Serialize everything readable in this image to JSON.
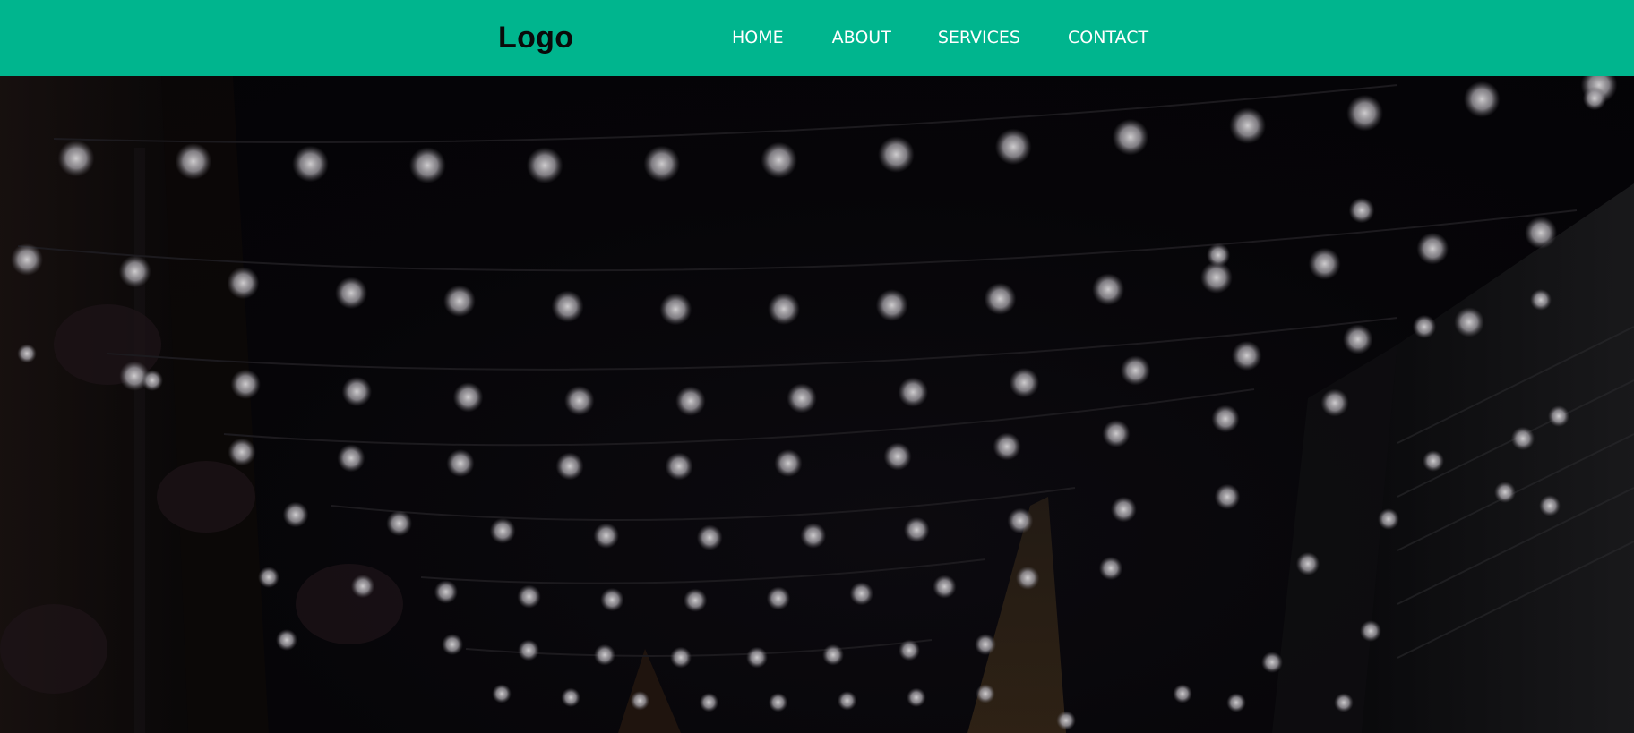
{
  "header": {
    "logo": "Logo",
    "nav": [
      {
        "label": "HOME"
      },
      {
        "label": "ABOUT"
      },
      {
        "label": "SERVICES"
      },
      {
        "label": "CONTACT"
      }
    ]
  },
  "hero": {
    "image_subject": "string-lights-alley-night"
  },
  "colors": {
    "header_bg": "#00b58e",
    "logo": "#0a0a0a",
    "nav_text": "#ffffff",
    "hero_bg": "#050407"
  }
}
